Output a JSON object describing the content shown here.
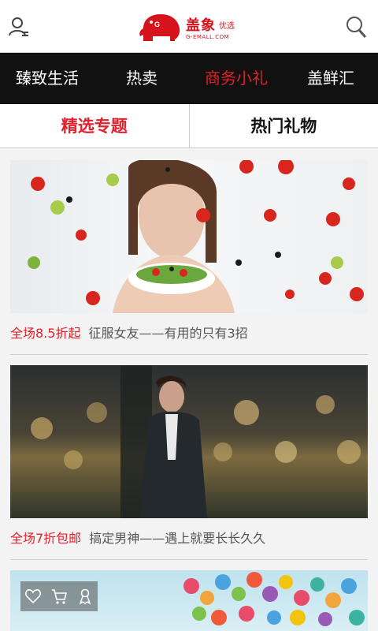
{
  "header": {
    "logo_text": "盖象",
    "logo_sub": "优选",
    "logo_url": "G-EMALL.COM",
    "user_icon": "user-icon",
    "search_icon": "search-icon"
  },
  "category_nav": {
    "items": [
      {
        "label": "臻致生活"
      },
      {
        "label": "热卖"
      },
      {
        "label": "商务小礼"
      },
      {
        "label": "盖鲜汇"
      }
    ],
    "active_index": 2
  },
  "sub_tabs": {
    "items": [
      {
        "label": "精选专题"
      },
      {
        "label": "热门礼物"
      }
    ],
    "active_index": 0
  },
  "cards": [
    {
      "promo": "全场8.5折起",
      "desc": "征服女友——有用的只有3招"
    },
    {
      "promo": "全场7折包邮",
      "desc": "搞定男神——遇上就要长长久久"
    },
    {
      "actions": [
        "heart-icon",
        "cart-icon",
        "ribbon-icon"
      ]
    }
  ],
  "colors": {
    "accent": "#e0202a",
    "nav_bg": "#111111"
  }
}
